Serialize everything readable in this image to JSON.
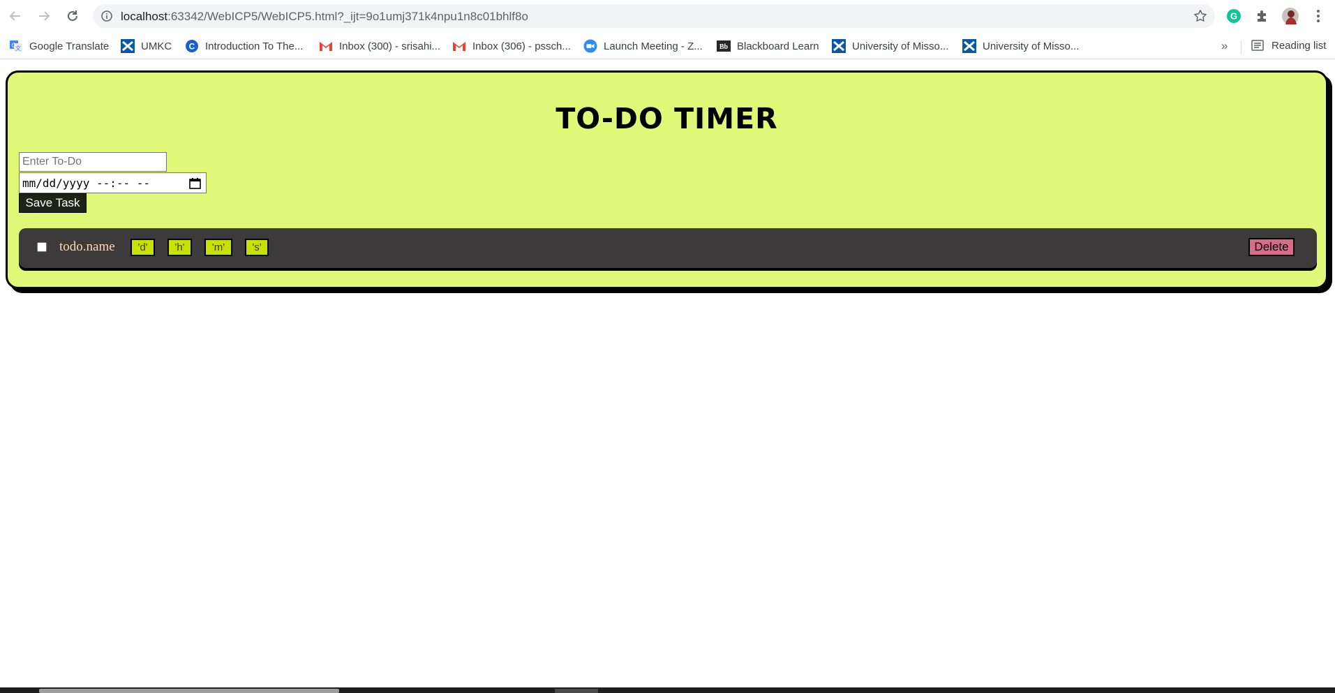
{
  "browser": {
    "url_host": "localhost",
    "url_rest": ":63342/WebICP5/WebICP5.html?_ijt=9o1umj371k4npu1n8c01bhlf8o",
    "bookmarks": [
      {
        "label": "Google Translate",
        "icon": "google-translate-icon"
      },
      {
        "label": "UMKC",
        "icon": "umkc-icon"
      },
      {
        "label": "Introduction To The...",
        "icon": "c-logo-icon"
      },
      {
        "label": "Inbox (300) - srisahi...",
        "icon": "gmail-icon"
      },
      {
        "label": "Inbox (306) - pssch...",
        "icon": "gmail-icon"
      },
      {
        "label": "Launch Meeting - Z...",
        "icon": "zoom-icon"
      },
      {
        "label": "Blackboard Learn",
        "icon": "blackboard-icon"
      },
      {
        "label": "University of Misso...",
        "icon": "umkc-icon"
      },
      {
        "label": "University of Misso...",
        "icon": "umkc-icon"
      }
    ],
    "more_label": "»",
    "reading_list_label": "Reading list"
  },
  "app": {
    "title": "TO-DO TIMER",
    "todo_placeholder": "Enter To-Do",
    "datetime_placeholder": "mm/dd/yyyy --:-- --",
    "save_label": "Save Task",
    "todo": {
      "name": "todo.name",
      "days": "'d'",
      "hours": "'h'",
      "minutes": "'m'",
      "seconds": "'s'",
      "delete_label": "Delete"
    }
  },
  "colors": {
    "app_bg": "#e1f777",
    "todo_row_bg": "#3c3a3a",
    "timer_box_bg": "#c8e200",
    "delete_bg": "#d86a8b",
    "save_bg": "#1e2318"
  }
}
